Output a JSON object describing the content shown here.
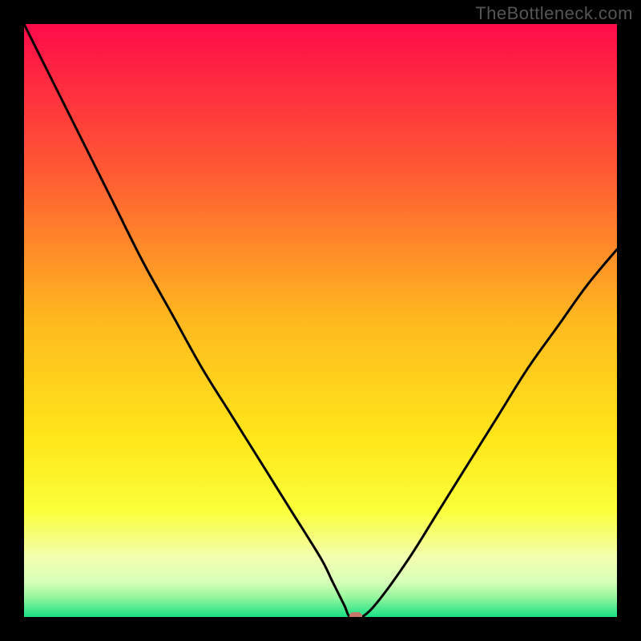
{
  "watermark": "TheBottleneck.com",
  "chart_data": {
    "type": "line",
    "title": "",
    "xlabel": "",
    "ylabel": "",
    "xlim": [
      0,
      100
    ],
    "ylim": [
      0,
      100
    ],
    "series": [
      {
        "name": "bottleneck-curve",
        "x": [
          0,
          5,
          10,
          15,
          20,
          25,
          30,
          35,
          40,
          45,
          50,
          52,
          54,
          55,
          57,
          60,
          65,
          70,
          75,
          80,
          85,
          90,
          95,
          100
        ],
        "y": [
          100,
          90,
          80,
          70,
          60,
          51,
          42,
          34,
          26,
          18,
          10,
          6,
          2,
          0,
          0,
          3,
          10,
          18,
          26,
          34,
          42,
          49,
          56,
          62
        ]
      }
    ],
    "marker": {
      "x": 56,
      "y": 0,
      "color": "#c8786a"
    },
    "gradient_stops": [
      {
        "offset": 0.0,
        "color": "#ff0b49"
      },
      {
        "offset": 0.25,
        "color": "#ff5a33"
      },
      {
        "offset": 0.5,
        "color": "#ffb91f"
      },
      {
        "offset": 0.7,
        "color": "#ffe619"
      },
      {
        "offset": 0.82,
        "color": "#fbff3a"
      },
      {
        "offset": 0.9,
        "color": "#f3ffb0"
      },
      {
        "offset": 0.94,
        "color": "#d8ffb8"
      },
      {
        "offset": 0.965,
        "color": "#9cf7a0"
      },
      {
        "offset": 1.0,
        "color": "#18e084"
      }
    ]
  }
}
